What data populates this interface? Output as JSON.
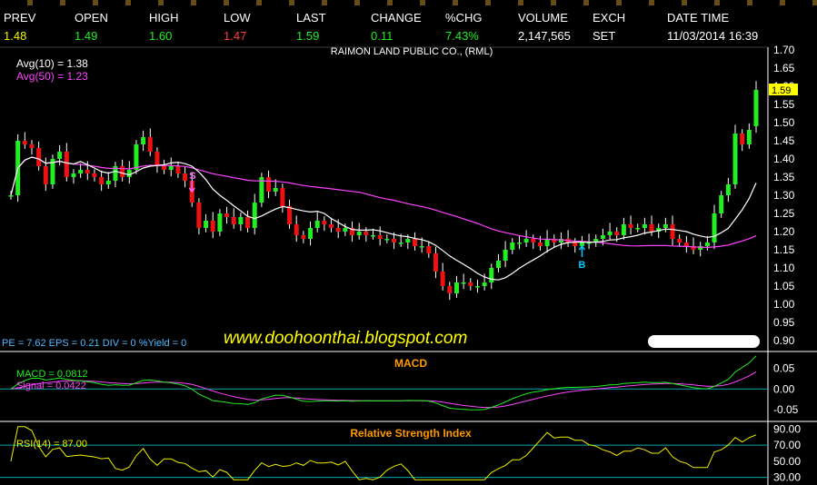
{
  "header": {
    "columns": [
      {
        "label": "PREV",
        "value": "1.48",
        "color": "#f2f200"
      },
      {
        "label": "OPEN",
        "value": "1.49",
        "color": "#22ee22"
      },
      {
        "label": "HIGH",
        "value": "1.60",
        "color": "#22ee22"
      },
      {
        "label": "LOW",
        "value": "1.47",
        "color": "#ff3b3b"
      },
      {
        "label": "LAST",
        "value": "1.59",
        "color": "#22ee22"
      },
      {
        "label": "CHANGE",
        "value": "0.11",
        "color": "#22ee22"
      },
      {
        "label": "%CHG",
        "value": "7.43%",
        "color": "#22ee22"
      },
      {
        "label": "VOLUME",
        "value": "2,147,565",
        "color": "#ffffff"
      },
      {
        "label": "EXCH",
        "value": "SET",
        "color": "#ffffff"
      },
      {
        "label": "DATE TIME",
        "value": "11/03/2014 16:39",
        "color": "#ffffff"
      }
    ]
  },
  "chart_data": [
    {
      "type": "candlestick",
      "title": "RAIMON LAND PUBLIC CO., (RML)",
      "legend": [
        {
          "label": "Avg(10)",
          "value": "1.38",
          "color": "#ffffff"
        },
        {
          "label": "Avg(50)",
          "value": "1.23",
          "color": "#ff44ff"
        }
      ],
      "ticks": [
        "1.70",
        "1.65",
        "1.60",
        "1.55",
        "1.50",
        "1.45",
        "1.40",
        "1.35",
        "1.30",
        "1.25",
        "1.20",
        "1.15",
        "1.10",
        "1.05",
        "1.00",
        "0.95",
        "0.90"
      ],
      "ylim": [
        0.9,
        1.7
      ],
      "last_marker": "1.59",
      "fundamentals": "PE = 7.62   EPS = 0.21   DIV = 0   %Yield = 0",
      "watermark": "www.doohoonthai.blogspot.com",
      "signals": [
        {
          "label": "S",
          "index": 26,
          "price": 1.32,
          "color": "#ff66ff"
        },
        {
          "label": "B",
          "index": 82,
          "price": 1.13,
          "color": "#00ccff"
        }
      ],
      "closes": [
        1.3,
        1.45,
        1.44,
        1.43,
        1.38,
        1.33,
        1.4,
        1.42,
        1.35,
        1.36,
        1.37,
        1.36,
        1.35,
        1.33,
        1.34,
        1.38,
        1.35,
        1.37,
        1.44,
        1.46,
        1.42,
        1.38,
        1.37,
        1.38,
        1.36,
        1.34,
        1.28,
        1.21,
        1.23,
        1.2,
        1.25,
        1.24,
        1.22,
        1.24,
        1.21,
        1.28,
        1.35,
        1.31,
        1.32,
        1.27,
        1.22,
        1.19,
        1.18,
        1.21,
        1.23,
        1.22,
        1.21,
        1.2,
        1.21,
        1.19,
        1.2,
        1.19,
        1.19,
        1.18,
        1.18,
        1.17,
        1.17,
        1.18,
        1.16,
        1.16,
        1.14,
        1.09,
        1.05,
        1.03,
        1.06,
        1.06,
        1.05,
        1.05,
        1.06,
        1.1,
        1.12,
        1.15,
        1.17,
        1.17,
        1.18,
        1.17,
        1.16,
        1.18,
        1.17,
        1.18,
        1.17,
        1.16,
        1.17,
        1.17,
        1.18,
        1.19,
        1.2,
        1.19,
        1.22,
        1.21,
        1.21,
        1.22,
        1.2,
        1.21,
        1.22,
        1.18,
        1.17,
        1.16,
        1.15,
        1.16,
        1.17,
        1.25,
        1.3,
        1.33,
        1.47,
        1.44,
        1.48,
        1.59
      ]
    },
    {
      "type": "line",
      "title": "MACD",
      "legend": [
        {
          "label": "MACD",
          "value": "0.0812",
          "color": "#22ee22"
        },
        {
          "label": "Signal",
          "value": "0.0422",
          "color": "#ff44ff"
        }
      ],
      "ticks": [
        "0.05",
        "0.00",
        "-0.05"
      ],
      "ylim": [
        -0.07,
        0.08
      ],
      "zero_line": 0
    },
    {
      "type": "line",
      "title": "Relative Strength Index",
      "legend": [
        {
          "label": "RSI(14)",
          "value": "87.00",
          "color": "#eeee00"
        }
      ],
      "ticks": [
        "90.00",
        "70.00",
        "50.00",
        "30.00"
      ],
      "ylim": [
        25,
        95
      ],
      "levels": [
        70,
        30
      ]
    }
  ]
}
